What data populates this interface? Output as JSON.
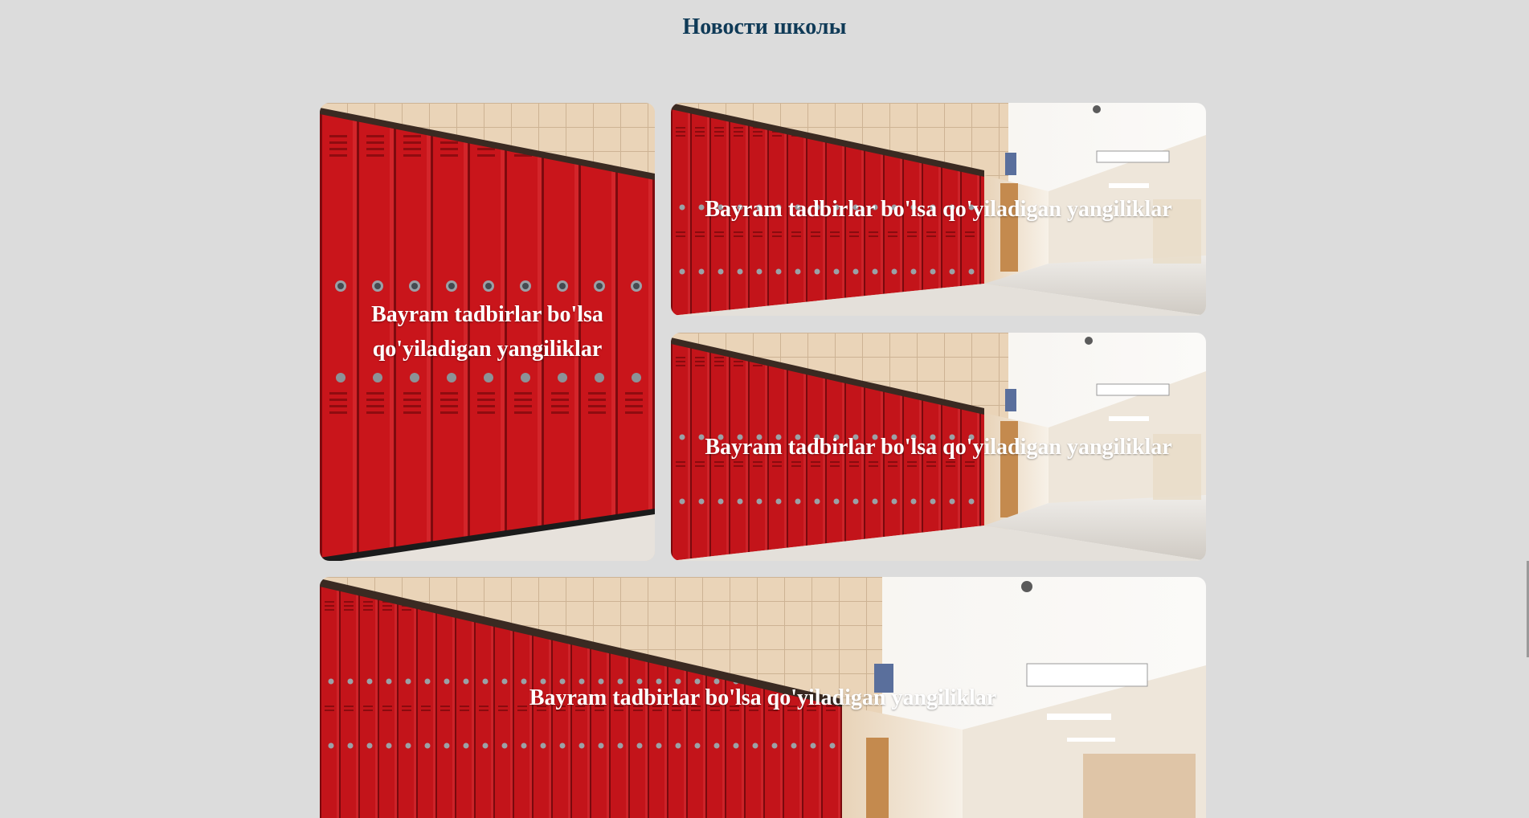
{
  "page": {
    "title": "Новости школы",
    "background_color": "#dcdcdc",
    "title_color": "#0f3a57"
  },
  "news": [
    {
      "caption": "Bayram tadbirlar bo'lsa qo'yiladigan yangiliklar",
      "image": "red-lockers-closeup"
    },
    {
      "caption": "Bayram tadbirlar bo'lsa qo'yiladigan yangiliklar",
      "image": "school-hallway-lockers"
    },
    {
      "caption": "Bayram tadbirlar bo'lsa qo'yiladigan yangiliklar",
      "image": "school-hallway-lockers"
    },
    {
      "caption": "Bayram tadbirlar bo'lsa qo'yiladigan yangiliklar",
      "image": "school-hallway-lockers"
    }
  ],
  "colors": {
    "locker_red": "#c8141a",
    "wall_beige": "#e8d2b6",
    "floor_grey": "#e6e2dc"
  }
}
